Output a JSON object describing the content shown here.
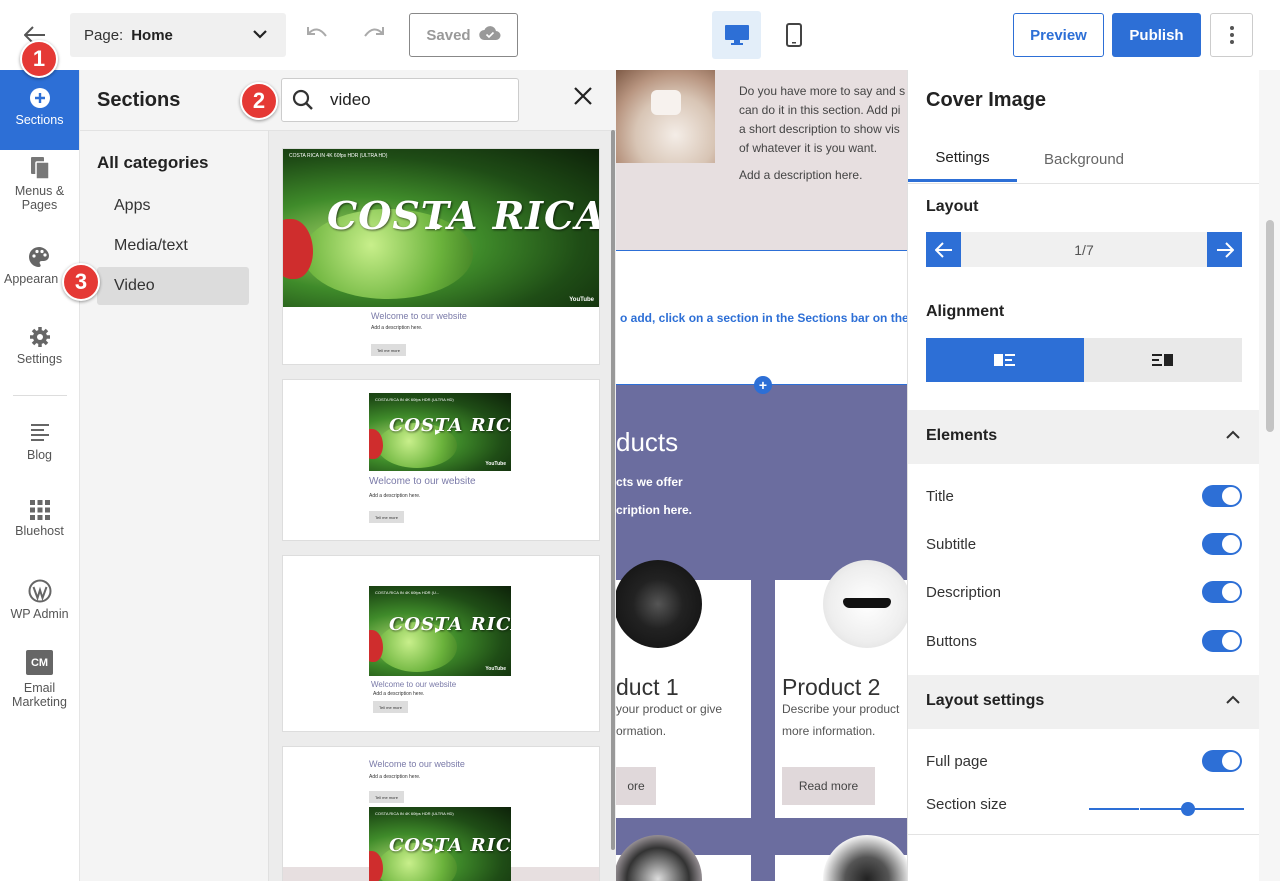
{
  "toolbar": {
    "page_label": "Page:",
    "page_value": "Home",
    "saved_label": "Saved",
    "preview_label": "Preview",
    "publish_label": "Publish"
  },
  "leftnav": {
    "items": [
      {
        "label": "Sections",
        "icon": "plus-circle-icon"
      },
      {
        "label": "Menus & Pages",
        "icon": "pages-icon"
      },
      {
        "label": "Appearance",
        "icon": "palette-icon"
      },
      {
        "label": "Settings",
        "icon": "gear-icon"
      },
      {
        "label": "Blog",
        "icon": "blog-icon"
      },
      {
        "label": "Bluehost",
        "icon": "grid-icon"
      },
      {
        "label": "WP Admin",
        "icon": "wordpress-icon"
      },
      {
        "label": "Email Marketing",
        "icon": "cm-icon"
      }
    ],
    "visible_labels": {
      "sections": "Sections",
      "menus1": "Menus &",
      "menus2": "Pages",
      "appearance": "Appearan",
      "settings": "Settings",
      "blog": "Blog",
      "bluehost": "Bluehost",
      "wpadmin": "WP Admin",
      "cm_badge": "CM",
      "email1": "Email",
      "email2": "Marketing"
    }
  },
  "sections_panel": {
    "title": "Sections",
    "search_value": "video",
    "categories_heading": "All categories",
    "categories": [
      "Apps",
      "Media/text",
      "Video"
    ],
    "selected_category": "Video",
    "thumbnails": {
      "video_title": "COSTA RICA",
      "video_topline": "COSTA RICA IN 4K 60fps HDR (ULTRA HD)",
      "video_topline_short": "COSTA RICA IN 4K 60fps HDR (U...",
      "youtube_label": "YouTube",
      "welcome": "Welcome to our website",
      "desc": "Add a description here.",
      "button": "Tell me more"
    }
  },
  "canvas": {
    "intro_lines": [
      "Do you have more to say and s",
      "can do it in this section. Add pi",
      "a short description to show vis",
      "of whatever it is you want."
    ],
    "add_desc": "Add a description here.",
    "empty_msg": "o add, click on a section in the Sections bar on the le",
    "products_title": "ducts",
    "products_sub": "cts we offer",
    "products_desc": "cription here.",
    "product1": {
      "title": "duct 1",
      "desc1": "your product or give",
      "desc2": "ormation.",
      "button": "ore"
    },
    "product2": {
      "title": "Product 2",
      "desc1": "Describe your product",
      "desc2": "more information.",
      "button": "Read more"
    }
  },
  "right_panel": {
    "title": "Cover Image",
    "tabs": [
      "Settings",
      "Background"
    ],
    "active_tab": "Settings",
    "layout_label": "Layout",
    "layout_value": "1/7",
    "alignment_label": "Alignment",
    "alignment_selected": "left",
    "elements_label": "Elements",
    "elements": [
      {
        "label": "Title",
        "on": true
      },
      {
        "label": "Subtitle",
        "on": true
      },
      {
        "label": "Description",
        "on": true
      },
      {
        "label": "Buttons",
        "on": true
      }
    ],
    "layout_settings_label": "Layout settings",
    "full_page_label": "Full page",
    "full_page_on": true,
    "section_size_label": "Section size",
    "section_size_value": 0.65
  },
  "markers": [
    "1",
    "2",
    "3"
  ],
  "colors": {
    "accent": "#2d6fd6",
    "marker": "#e53935",
    "products_bg": "#6b6d9f"
  }
}
